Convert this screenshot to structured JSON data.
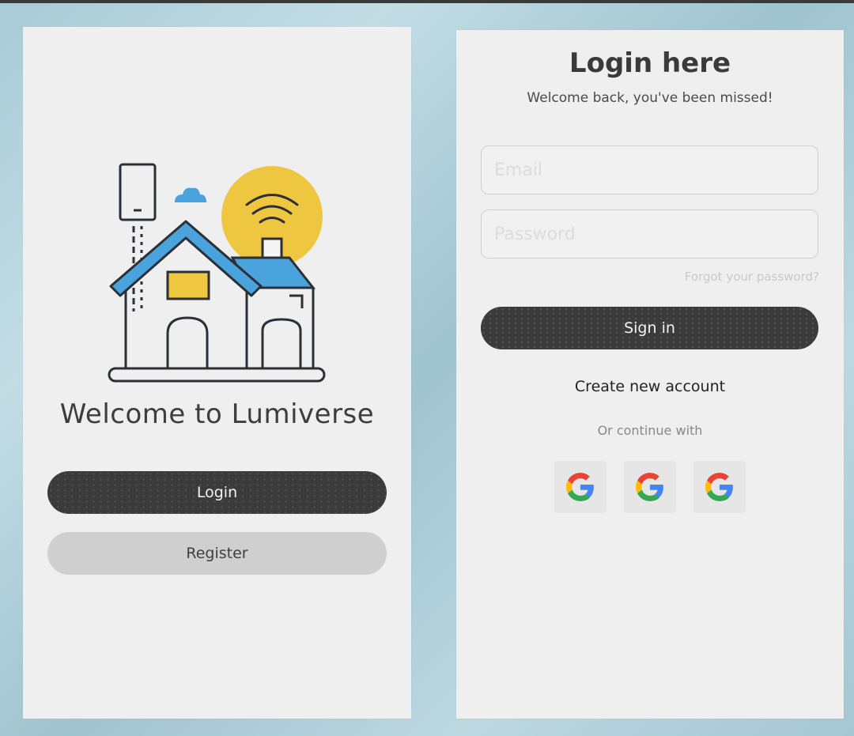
{
  "welcome": {
    "title": "Welcome to Lumiverse",
    "login_label": "Login",
    "register_label": "Register"
  },
  "login": {
    "title": "Login here",
    "subtitle": "Welcome back, you've been missed!",
    "email_placeholder": "Email",
    "password_placeholder": "Password",
    "forgot_label": "Forgot your password?",
    "signin_label": "Sign in",
    "create_label": "Create new account",
    "or_label": "Or continue with",
    "social": [
      "google-icon",
      "google-icon",
      "google-icon"
    ]
  },
  "colors": {
    "dark_button": "#3b3b3b",
    "light_button": "#cfcfcf",
    "house_roof": "#4aa3dc",
    "sun": "#efc640",
    "background": "#a9cbd6"
  }
}
